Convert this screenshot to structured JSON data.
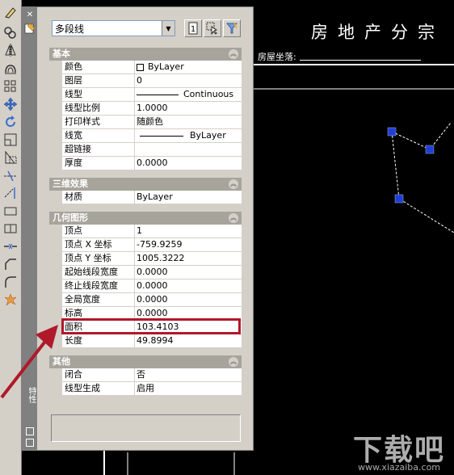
{
  "toolbar": {
    "tools": [
      "erase-icon",
      "copy-icon",
      "mirror-icon",
      "offset-icon",
      "array-icon",
      "move-icon",
      "rotate-icon",
      "scale-icon",
      "stretch-icon",
      "trim-icon",
      "extend-icon",
      "break-at-point-icon",
      "break-icon",
      "join-icon",
      "chamfer-icon",
      "fillet-icon",
      "explode-icon"
    ]
  },
  "drawing": {
    "title": "房地产分宗",
    "address_label": "房屋坐落:"
  },
  "palette": {
    "title": "特性",
    "object_type": "多段线",
    "sections": {
      "basic": "基本",
      "3d": "三维效果",
      "geometry": "几何图形",
      "misc": "其他"
    },
    "basic_rows": [
      {
        "name": "颜色",
        "value": "ByLayer"
      },
      {
        "name": "图层",
        "value": "0"
      },
      {
        "name": "线型",
        "value": "Continuous"
      },
      {
        "name": "线型比例",
        "value": "1.0000"
      },
      {
        "name": "打印样式",
        "value": "随颜色"
      },
      {
        "name": "线宽",
        "value": "ByLayer"
      },
      {
        "name": "超链接",
        "value": ""
      },
      {
        "name": "厚度",
        "value": "0.0000"
      }
    ],
    "three_d_rows": [
      {
        "name": "材质",
        "value": "ByLayer"
      }
    ],
    "geometry_rows": [
      {
        "name": "顶点",
        "value": "1"
      },
      {
        "name": "顶点 X 坐标",
        "value": "-759.9259"
      },
      {
        "name": "顶点 Y 坐标",
        "value": "1005.3222"
      },
      {
        "name": "起始线段宽度",
        "value": "0.0000"
      },
      {
        "name": "终止线段宽度",
        "value": "0.0000"
      },
      {
        "name": "全局宽度",
        "value": "0.0000"
      },
      {
        "name": "标高",
        "value": "0.0000"
      },
      {
        "name": "面积",
        "value": "103.4103"
      },
      {
        "name": "长度",
        "value": "49.8994"
      }
    ],
    "misc_rows": [
      {
        "name": "闭合",
        "value": "否"
      },
      {
        "name": "线型生成",
        "value": "启用"
      }
    ]
  },
  "colors": {
    "highlight": "#b0192a",
    "grip": "#1f3fd6",
    "panel": "#d4d0c8"
  },
  "watermark": {
    "text": "下载吧",
    "url": "www.xiazaiba.com"
  }
}
